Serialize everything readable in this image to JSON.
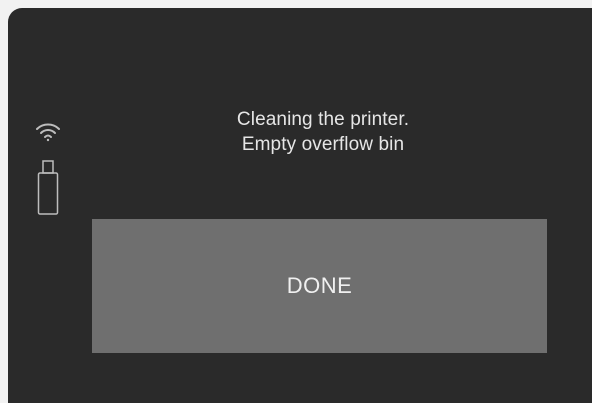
{
  "status": {
    "wifi_icon": "wifi-icon",
    "usb_icon": "usb-drive-icon"
  },
  "message": {
    "line1": "Cleaning the printer.",
    "line2": "Empty overflow bin"
  },
  "actions": {
    "done_label": "DONE"
  },
  "colors": {
    "screen_background": "#2a2a2a",
    "button_background": "#6f6f6f",
    "text": "#e6e6e6"
  }
}
